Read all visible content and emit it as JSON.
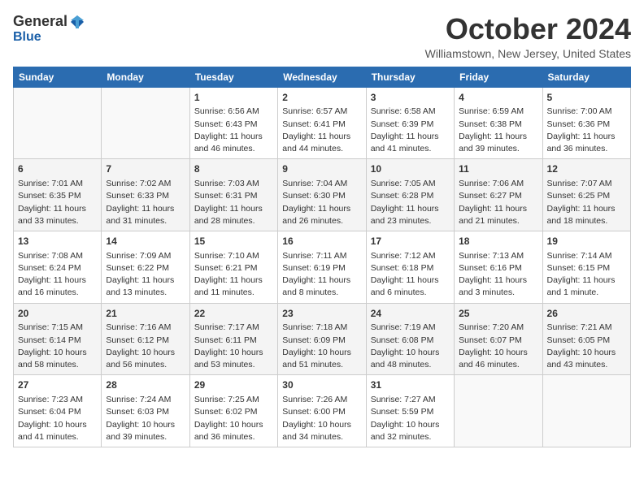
{
  "header": {
    "logo_general": "General",
    "logo_blue": "Blue",
    "month_title": "October 2024",
    "location": "Williamstown, New Jersey, United States"
  },
  "weekdays": [
    "Sunday",
    "Monday",
    "Tuesday",
    "Wednesday",
    "Thursday",
    "Friday",
    "Saturday"
  ],
  "weeks": [
    [
      {
        "day": "",
        "sunrise": "",
        "sunset": "",
        "daylight": ""
      },
      {
        "day": "",
        "sunrise": "",
        "sunset": "",
        "daylight": ""
      },
      {
        "day": "1",
        "sunrise": "Sunrise: 6:56 AM",
        "sunset": "Sunset: 6:43 PM",
        "daylight": "Daylight: 11 hours and 46 minutes."
      },
      {
        "day": "2",
        "sunrise": "Sunrise: 6:57 AM",
        "sunset": "Sunset: 6:41 PM",
        "daylight": "Daylight: 11 hours and 44 minutes."
      },
      {
        "day": "3",
        "sunrise": "Sunrise: 6:58 AM",
        "sunset": "Sunset: 6:39 PM",
        "daylight": "Daylight: 11 hours and 41 minutes."
      },
      {
        "day": "4",
        "sunrise": "Sunrise: 6:59 AM",
        "sunset": "Sunset: 6:38 PM",
        "daylight": "Daylight: 11 hours and 39 minutes."
      },
      {
        "day": "5",
        "sunrise": "Sunrise: 7:00 AM",
        "sunset": "Sunset: 6:36 PM",
        "daylight": "Daylight: 11 hours and 36 minutes."
      }
    ],
    [
      {
        "day": "6",
        "sunrise": "Sunrise: 7:01 AM",
        "sunset": "Sunset: 6:35 PM",
        "daylight": "Daylight: 11 hours and 33 minutes."
      },
      {
        "day": "7",
        "sunrise": "Sunrise: 7:02 AM",
        "sunset": "Sunset: 6:33 PM",
        "daylight": "Daylight: 11 hours and 31 minutes."
      },
      {
        "day": "8",
        "sunrise": "Sunrise: 7:03 AM",
        "sunset": "Sunset: 6:31 PM",
        "daylight": "Daylight: 11 hours and 28 minutes."
      },
      {
        "day": "9",
        "sunrise": "Sunrise: 7:04 AM",
        "sunset": "Sunset: 6:30 PM",
        "daylight": "Daylight: 11 hours and 26 minutes."
      },
      {
        "day": "10",
        "sunrise": "Sunrise: 7:05 AM",
        "sunset": "Sunset: 6:28 PM",
        "daylight": "Daylight: 11 hours and 23 minutes."
      },
      {
        "day": "11",
        "sunrise": "Sunrise: 7:06 AM",
        "sunset": "Sunset: 6:27 PM",
        "daylight": "Daylight: 11 hours and 21 minutes."
      },
      {
        "day": "12",
        "sunrise": "Sunrise: 7:07 AM",
        "sunset": "Sunset: 6:25 PM",
        "daylight": "Daylight: 11 hours and 18 minutes."
      }
    ],
    [
      {
        "day": "13",
        "sunrise": "Sunrise: 7:08 AM",
        "sunset": "Sunset: 6:24 PM",
        "daylight": "Daylight: 11 hours and 16 minutes."
      },
      {
        "day": "14",
        "sunrise": "Sunrise: 7:09 AM",
        "sunset": "Sunset: 6:22 PM",
        "daylight": "Daylight: 11 hours and 13 minutes."
      },
      {
        "day": "15",
        "sunrise": "Sunrise: 7:10 AM",
        "sunset": "Sunset: 6:21 PM",
        "daylight": "Daylight: 11 hours and 11 minutes."
      },
      {
        "day": "16",
        "sunrise": "Sunrise: 7:11 AM",
        "sunset": "Sunset: 6:19 PM",
        "daylight": "Daylight: 11 hours and 8 minutes."
      },
      {
        "day": "17",
        "sunrise": "Sunrise: 7:12 AM",
        "sunset": "Sunset: 6:18 PM",
        "daylight": "Daylight: 11 hours and 6 minutes."
      },
      {
        "day": "18",
        "sunrise": "Sunrise: 7:13 AM",
        "sunset": "Sunset: 6:16 PM",
        "daylight": "Daylight: 11 hours and 3 minutes."
      },
      {
        "day": "19",
        "sunrise": "Sunrise: 7:14 AM",
        "sunset": "Sunset: 6:15 PM",
        "daylight": "Daylight: 11 hours and 1 minute."
      }
    ],
    [
      {
        "day": "20",
        "sunrise": "Sunrise: 7:15 AM",
        "sunset": "Sunset: 6:14 PM",
        "daylight": "Daylight: 10 hours and 58 minutes."
      },
      {
        "day": "21",
        "sunrise": "Sunrise: 7:16 AM",
        "sunset": "Sunset: 6:12 PM",
        "daylight": "Daylight: 10 hours and 56 minutes."
      },
      {
        "day": "22",
        "sunrise": "Sunrise: 7:17 AM",
        "sunset": "Sunset: 6:11 PM",
        "daylight": "Daylight: 10 hours and 53 minutes."
      },
      {
        "day": "23",
        "sunrise": "Sunrise: 7:18 AM",
        "sunset": "Sunset: 6:09 PM",
        "daylight": "Daylight: 10 hours and 51 minutes."
      },
      {
        "day": "24",
        "sunrise": "Sunrise: 7:19 AM",
        "sunset": "Sunset: 6:08 PM",
        "daylight": "Daylight: 10 hours and 48 minutes."
      },
      {
        "day": "25",
        "sunrise": "Sunrise: 7:20 AM",
        "sunset": "Sunset: 6:07 PM",
        "daylight": "Daylight: 10 hours and 46 minutes."
      },
      {
        "day": "26",
        "sunrise": "Sunrise: 7:21 AM",
        "sunset": "Sunset: 6:05 PM",
        "daylight": "Daylight: 10 hours and 43 minutes."
      }
    ],
    [
      {
        "day": "27",
        "sunrise": "Sunrise: 7:23 AM",
        "sunset": "Sunset: 6:04 PM",
        "daylight": "Daylight: 10 hours and 41 minutes."
      },
      {
        "day": "28",
        "sunrise": "Sunrise: 7:24 AM",
        "sunset": "Sunset: 6:03 PM",
        "daylight": "Daylight: 10 hours and 39 minutes."
      },
      {
        "day": "29",
        "sunrise": "Sunrise: 7:25 AM",
        "sunset": "Sunset: 6:02 PM",
        "daylight": "Daylight: 10 hours and 36 minutes."
      },
      {
        "day": "30",
        "sunrise": "Sunrise: 7:26 AM",
        "sunset": "Sunset: 6:00 PM",
        "daylight": "Daylight: 10 hours and 34 minutes."
      },
      {
        "day": "31",
        "sunrise": "Sunrise: 7:27 AM",
        "sunset": "Sunset: 5:59 PM",
        "daylight": "Daylight: 10 hours and 32 minutes."
      },
      {
        "day": "",
        "sunrise": "",
        "sunset": "",
        "daylight": ""
      },
      {
        "day": "",
        "sunrise": "",
        "sunset": "",
        "daylight": ""
      }
    ]
  ]
}
